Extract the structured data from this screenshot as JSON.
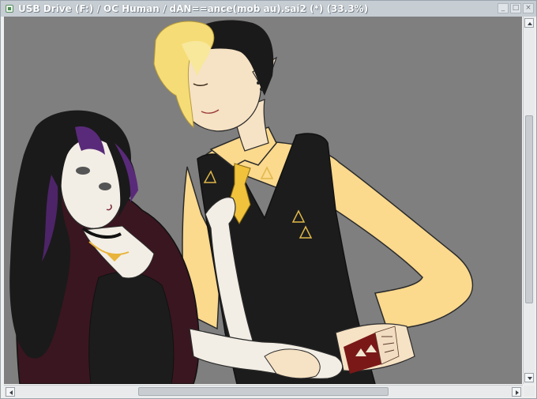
{
  "window": {
    "title": "USB Drive (F:) / OC Human / dAN==ance(mob au).sai2 (*) (33.3%)",
    "controls": {
      "minimize": "_",
      "maximize": "□",
      "close": "×"
    }
  },
  "canvas": {
    "zoom_percent": 33.3,
    "background_color": "#7f7f7f",
    "artwork_icon": "digital-illustration"
  },
  "scrollbars": {
    "vertical_icon_up": "arrow-up-icon",
    "vertical_icon_down": "arrow-down-icon",
    "horizontal_icon_left": "arrow-left-icon",
    "horizontal_icon_right": "arrow-right-icon"
  },
  "colors": {
    "titlebar": "#c6cdd3",
    "canvas_bg": "#7f7f7f",
    "shirt": "#fbd98d",
    "vest": "#1c1c1c",
    "hair_blond": "#f5dc76",
    "hair_black": "#1a1a1a",
    "dress": "#3a1620",
    "skin_pale": "#f3eee5"
  }
}
